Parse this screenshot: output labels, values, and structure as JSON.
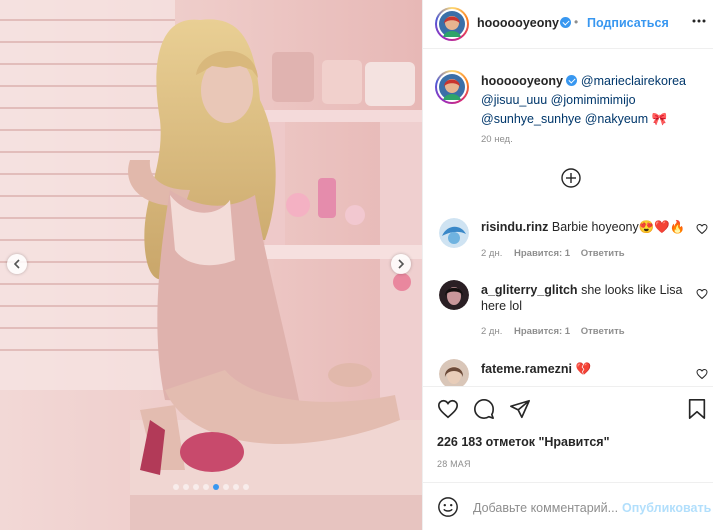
{
  "header": {
    "username": "hoooooyeony",
    "follow_label": "Подписаться",
    "more_icon": "ellipsis-icon"
  },
  "caption": {
    "username": "hoooooyeony",
    "line1_mention": "@marieclairekorea",
    "line2": "@jisuu_uuu @jomimimimijo",
    "line3": "@sunhye_sunhye @nakyeum",
    "emoji": "🎀",
    "time": "20 нед."
  },
  "load_more_icon": "plus-circle-icon",
  "comments": [
    {
      "username": "risindu.rinz",
      "text": "Barbie hoyeony😍❤️🔥",
      "time": "2 дн.",
      "likes": "Нравится: 1",
      "reply": "Ответить"
    },
    {
      "username": "a_gliterry_glitch",
      "text": "she looks like Lisa",
      "text2": "here lol",
      "time": "2 дн.",
      "likes": "Нравится: 1",
      "reply": "Ответить"
    },
    {
      "username": "fateme.ramezni",
      "text": "💔",
      "time": "",
      "likes": "",
      "reply": ""
    }
  ],
  "actions": {
    "like_icon": "heart-icon",
    "comment_icon": "comment-icon",
    "share_icon": "paper-plane-icon",
    "save_icon": "bookmark-icon"
  },
  "likes_text": "226 183 отметок \"Нравится\"",
  "date": "28 МАЯ",
  "composer": {
    "emoji_icon": "smiley-icon",
    "placeholder": "Добавьте комментарий...",
    "publish_label": "Опубликовать"
  },
  "carousel": {
    "total": 8,
    "active_index": 4
  },
  "colors": {
    "accent": "#3897f0",
    "link": "#00376b",
    "muted": "#8e8e8e",
    "heart_red": "#ed4956"
  }
}
